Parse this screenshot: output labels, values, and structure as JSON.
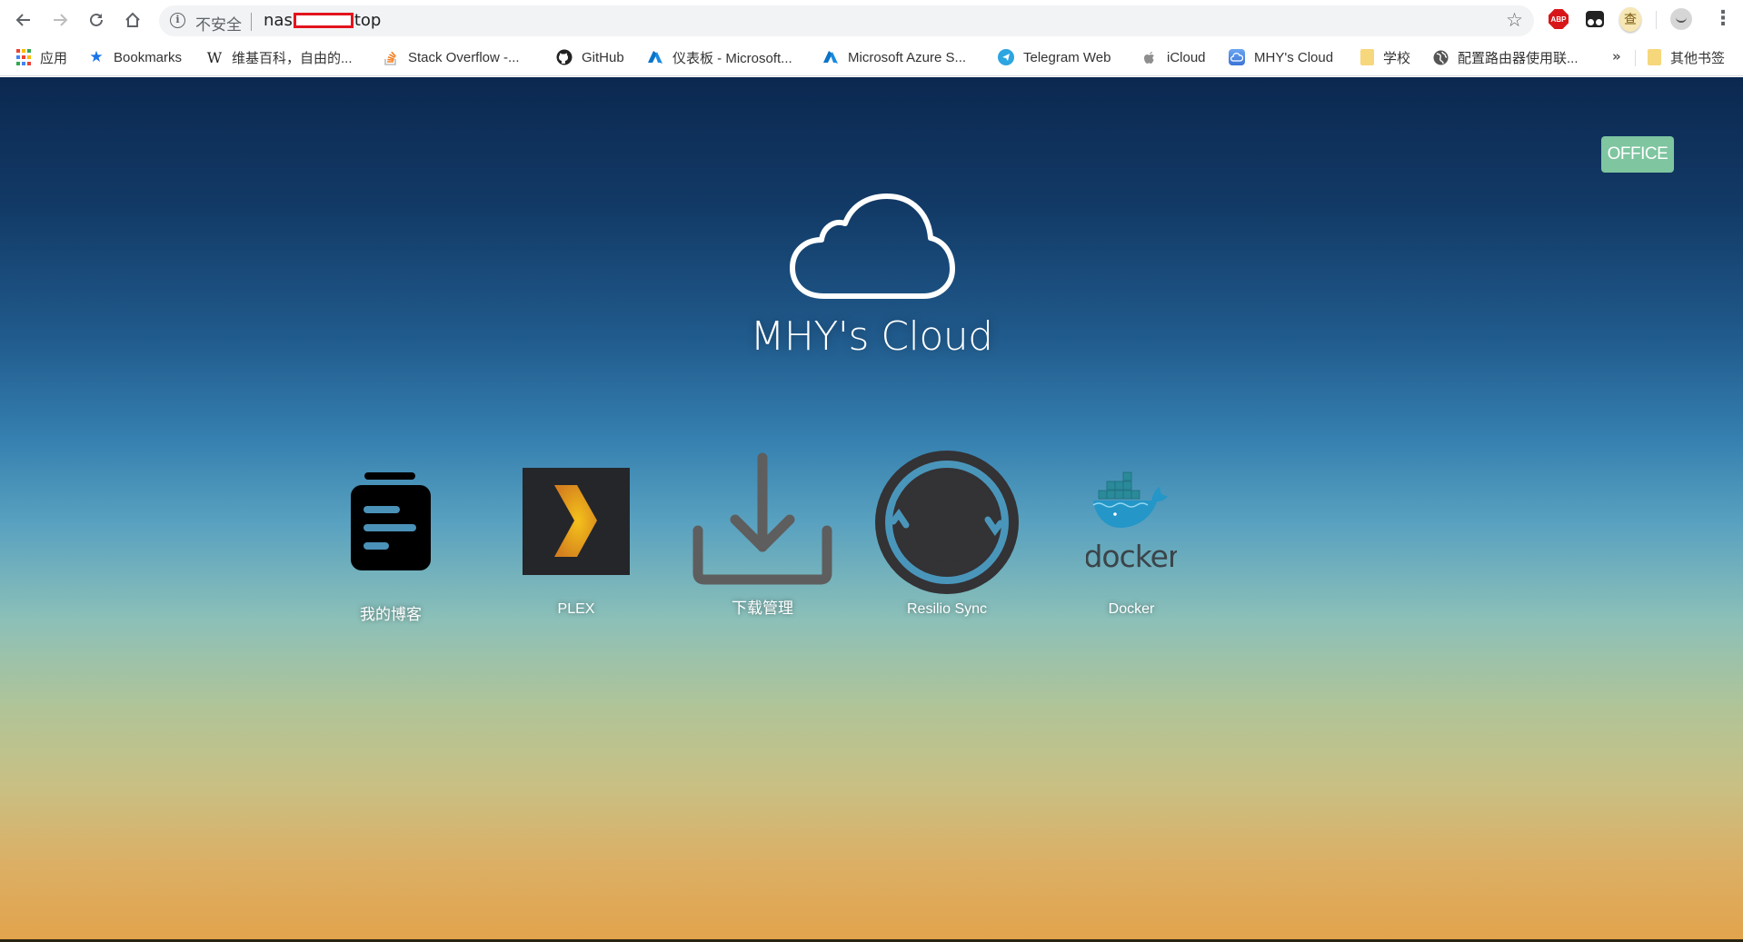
{
  "browser": {
    "nav": {
      "back": "back-arrow",
      "forward": "forward-arrow",
      "reload": "reload-icon",
      "home": "home-icon"
    },
    "address_bar": {
      "security_label": "不安全",
      "url_prefix": "nas",
      "url_suffix": "top",
      "redacted": true
    },
    "extensions": [
      "ABP",
      "tampermonkey",
      "查",
      "avatar"
    ],
    "abp_label": "ABP",
    "dict_label": "查",
    "menu_glyph": "⋮",
    "bookmarks": [
      {
        "label": "应用",
        "icon": "apps-grid-icon"
      },
      {
        "label": "Bookmarks",
        "icon": "star-icon"
      },
      {
        "label": "维基百科，自由的...",
        "icon": "wikipedia-icon"
      },
      {
        "label": "Stack Overflow -...",
        "icon": "stackoverflow-icon"
      },
      {
        "label": "GitHub",
        "icon": "github-icon"
      },
      {
        "label": "仪表板 - Microsoft...",
        "icon": "azure-icon"
      },
      {
        "label": "Microsoft Azure S...",
        "icon": "azure-icon"
      },
      {
        "label": "Telegram Web",
        "icon": "telegram-icon"
      },
      {
        "label": "iCloud",
        "icon": "apple-icon"
      },
      {
        "label": "MHY's Cloud",
        "icon": "cloud-icon"
      },
      {
        "label": "学校",
        "icon": "folder-icon"
      },
      {
        "label": "配置路由器使用联...",
        "icon": "globe-icon"
      }
    ],
    "overflow_label": "»",
    "other_bookmarks": "其他书签"
  },
  "page": {
    "office_button": "OFFICE",
    "title": "MHY's Cloud",
    "apps": [
      {
        "label": "我的博客",
        "icon": "blog-icon"
      },
      {
        "label": "PLEX",
        "icon": "plex-icon"
      },
      {
        "label": "下载管理",
        "icon": "download-icon"
      },
      {
        "label": "Resilio Sync",
        "icon": "resilio-sync-icon"
      },
      {
        "label": "Docker",
        "icon": "docker-icon",
        "logo_text": "docker"
      }
    ],
    "colors": {
      "office_button": "#7ec5a0",
      "gradient_top": "#0b2850",
      "gradient_bottom": "#e2a34c"
    }
  }
}
